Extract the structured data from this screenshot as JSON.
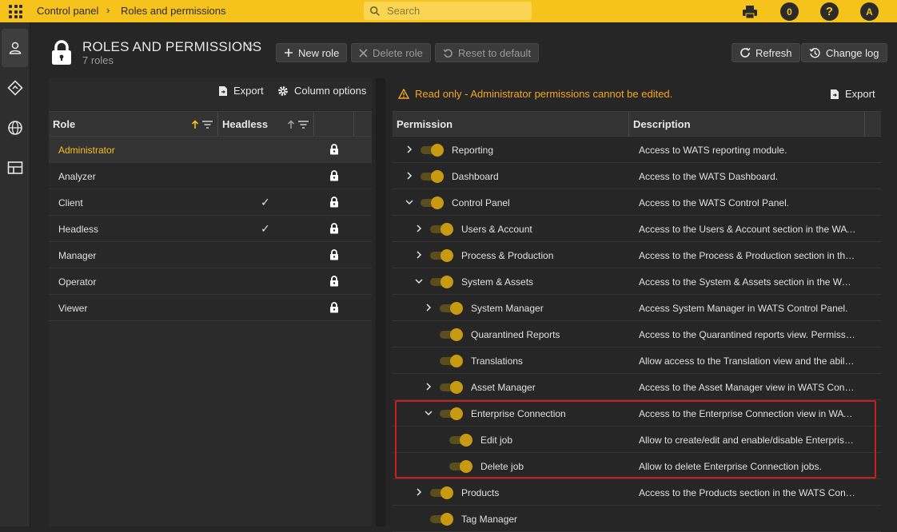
{
  "topbar": {
    "breadcrumb": [
      "Control panel",
      "Roles and permissions"
    ],
    "breadcrumb_separator": "›",
    "search_placeholder": "Search",
    "notification_count": "0",
    "help_label": "?",
    "avatar_initial": "A"
  },
  "sidebar": {
    "items": [
      {
        "icon": "user-icon"
      },
      {
        "icon": "flow-icon"
      },
      {
        "icon": "globe-icon"
      },
      {
        "icon": "layout-icon"
      }
    ]
  },
  "header": {
    "title": "ROLES AND PERMISSIONS",
    "subtitle": "7 roles",
    "star": "☆",
    "new_role": "New role",
    "delete_role": "Delete role",
    "reset_default": "Reset to default",
    "refresh": "Refresh",
    "change_log": "Change log"
  },
  "roles_panel": {
    "export": "Export",
    "column_options": "Column options",
    "columns": [
      "Role",
      "Headless"
    ],
    "rows": [
      {
        "name": "Administrator",
        "headless": "",
        "selected": true
      },
      {
        "name": "Analyzer",
        "headless": ""
      },
      {
        "name": "Client",
        "headless": "✓"
      },
      {
        "name": "Headless",
        "headless": "✓"
      },
      {
        "name": "Manager",
        "headless": ""
      },
      {
        "name": "Operator",
        "headless": ""
      },
      {
        "name": "Viewer",
        "headless": ""
      }
    ]
  },
  "permissions_panel": {
    "warning": "Read only - Administrator permissions cannot be edited.",
    "export": "Export",
    "columns": [
      "Permission",
      "Description"
    ],
    "rows": [
      {
        "level": 0,
        "chevron": "right",
        "name": "Reporting",
        "desc": "Access to WATS reporting module."
      },
      {
        "level": 0,
        "chevron": "right",
        "name": "Dashboard",
        "desc": "Access to the WATS Dashboard."
      },
      {
        "level": 0,
        "chevron": "down",
        "name": "Control Panel",
        "desc": "Access to the WATS Control Panel."
      },
      {
        "level": 1,
        "chevron": "right",
        "name": "Users & Account",
        "desc": "Access to the Users & Account section in the WATS ..."
      },
      {
        "level": 1,
        "chevron": "right",
        "name": "Process & Production",
        "desc": "Access to the Process & Production section in the ..."
      },
      {
        "level": 1,
        "chevron": "down",
        "name": "System & Assets",
        "desc": "Access to the System & Assets section in the WATS ..."
      },
      {
        "level": 2,
        "chevron": "right",
        "name": "System Manager",
        "desc": "Access System Manager in WATS Control Panel."
      },
      {
        "level": 2,
        "chevron": "",
        "name": "Quarantined Reports",
        "desc": "Access to the Quarantined reports view. Permissio..."
      },
      {
        "level": 2,
        "chevron": "",
        "name": "Translations",
        "desc": "Allow access to the Translation view and the ability ..."
      },
      {
        "level": 2,
        "chevron": "right",
        "name": "Asset Manager",
        "desc": "Access to the Asset Manager view in WATS Control ..."
      },
      {
        "level": 2,
        "chevron": "down",
        "name": "Enterprise Connection",
        "desc": "Access to the Enterprise Connection view in WATS ..."
      },
      {
        "level": 3,
        "chevron": "",
        "name": "Edit job",
        "desc": "Allow to create/edit and enable/disable Enterprise ..."
      },
      {
        "level": 3,
        "chevron": "",
        "name": "Delete job",
        "desc": "Allow to delete Enterprise Connection jobs."
      },
      {
        "level": 1,
        "chevron": "right",
        "name": "Products",
        "desc": "Access to the Products section in the WATS Control ..."
      },
      {
        "level": 1,
        "chevron": "",
        "name": "Tag Manager",
        "desc": ""
      }
    ]
  },
  "colors": {
    "accent": "#f6c21c",
    "warning": "#f5a623",
    "highlight_border": "#c8201d"
  }
}
